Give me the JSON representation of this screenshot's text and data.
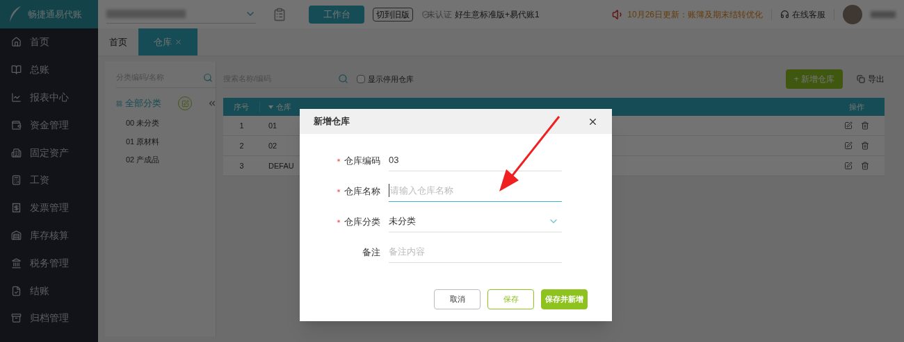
{
  "brand": {
    "name": "畅捷通易代账"
  },
  "topbar": {
    "workbench_button": "工作台",
    "old_version_button": "切到旧版",
    "cert_status": "未认证",
    "product": "好生意标准版+易代账1",
    "notice": "10月26日更新：账簿及期末结转优化",
    "support": "在线客服"
  },
  "sidebar": {
    "items": [
      {
        "label": "首页"
      },
      {
        "label": "总账"
      },
      {
        "label": "报表中心"
      },
      {
        "label": "资金管理"
      },
      {
        "label": "固定资产"
      },
      {
        "label": "工资"
      },
      {
        "label": "发票管理"
      },
      {
        "label": "库存核算"
      },
      {
        "label": "税务管理"
      },
      {
        "label": "结账"
      },
      {
        "label": "归档管理"
      }
    ]
  },
  "tabs": [
    {
      "label": "首页",
      "selected": false,
      "closable": false
    },
    {
      "label": "仓库",
      "selected": true,
      "closable": true
    }
  ],
  "category_panel": {
    "search_placeholder": "分类编码/名称",
    "tree": [
      {
        "label": "全部分类",
        "selected": true,
        "children": [
          {
            "label": "00 未分类",
            "selected": false
          },
          {
            "label": "01 原材料",
            "selected": false
          },
          {
            "label": "02 产成品",
            "selected": false
          }
        ]
      }
    ]
  },
  "toolbar": {
    "search_placeholder": "搜索名称/编码",
    "show_disabled": {
      "label": "显示停用仓库",
      "checked": false
    },
    "add_button": "+ 新增仓库",
    "export_button": "导出"
  },
  "table": {
    "columns": [
      "序号",
      "仓库",
      "操作"
    ],
    "rows": [
      [
        "1",
        "01"
      ],
      [
        "2",
        "02"
      ],
      [
        "3",
        "DEFAU"
      ]
    ]
  },
  "dialog": {
    "title": "新增仓库",
    "fields": [
      {
        "kind": "text",
        "label": "仓库编码",
        "required": true,
        "value": "03",
        "focused": false
      },
      {
        "kind": "text",
        "label": "仓库名称",
        "required": true,
        "placeholder": "请输入仓库名称",
        "focused": true
      },
      {
        "kind": "select",
        "label": "仓库分类",
        "required": true,
        "value": "未分类",
        "focused": false
      },
      {
        "kind": "text",
        "label": "备注",
        "required": false,
        "placeholder": "备注内容",
        "focused": false
      }
    ],
    "buttons": [
      {
        "label": "取消",
        "kind": "plain"
      },
      {
        "label": "保存",
        "kind": "outline"
      },
      {
        "label": "保存并新增",
        "kind": "primary"
      }
    ]
  }
}
